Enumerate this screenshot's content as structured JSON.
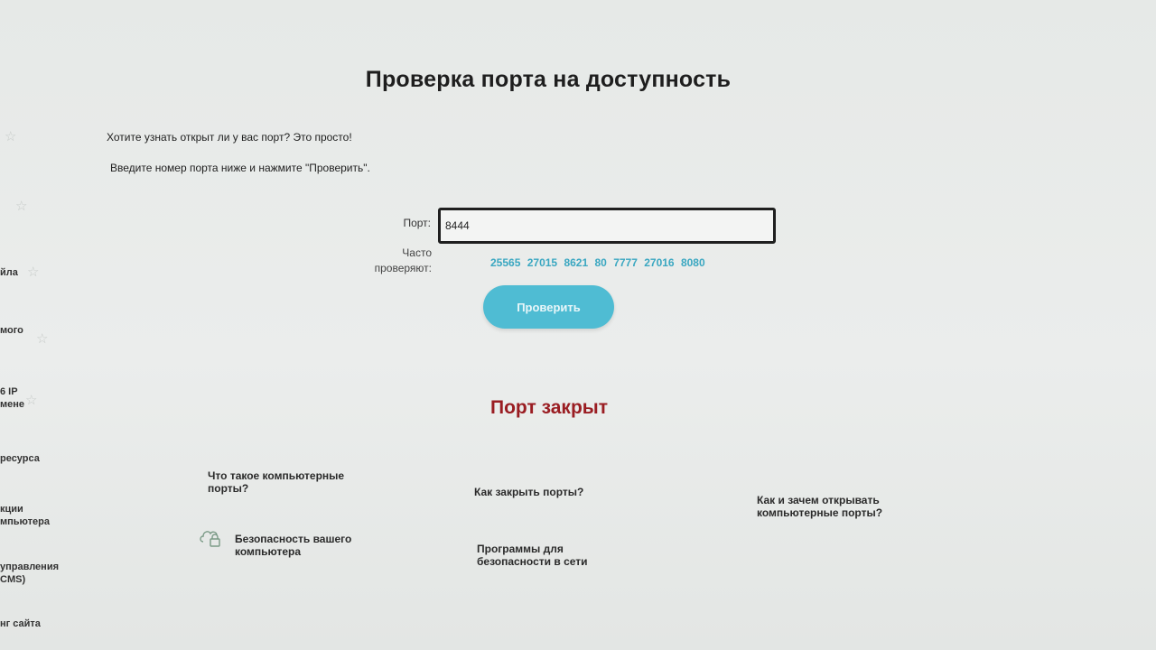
{
  "page": {
    "title": "Проверка порта на доступность",
    "intro_line1": "Хотите узнать открыт ли у вас порт? Это просто!",
    "intro_line2": "Введите номер порта ниже и нажмите \"Проверить\"."
  },
  "form": {
    "port_label": "Порт:",
    "port_value": "8444",
    "often_label_line1": "Часто",
    "often_label_line2": "проверяют:",
    "often_ports": [
      "25565",
      "27015",
      "8621",
      "80",
      "7777",
      "27016",
      "8080"
    ],
    "check_button": "Проверить"
  },
  "result": {
    "text": "Порт закрыт",
    "color": "#9a1d22"
  },
  "links": {
    "what_ports_line1": "Что такое компьютерные",
    "what_ports_line2": "порты?",
    "how_close": "Как закрыть порты?",
    "how_open_line1": "Как и зачем открывать",
    "how_open_line2": "компьютерные порты?",
    "security_line1": "Безопасность вашего",
    "security_line2": "компьютера",
    "programs_line1": "Программы для",
    "programs_line2": "безопасности в сети"
  },
  "sidebar": {
    "items": [
      "йла",
      "мого",
      "6 IP",
      "мене",
      "ресурса",
      "кции",
      "мпьютера",
      "управления",
      "CMS)",
      "нг сайта"
    ]
  },
  "colors": {
    "accent": "#4fbcd3",
    "link": "#3aa7c1",
    "closed": "#9a1d22"
  },
  "icons": {
    "star": "star-icon",
    "lock": "cloud-lock-icon"
  }
}
